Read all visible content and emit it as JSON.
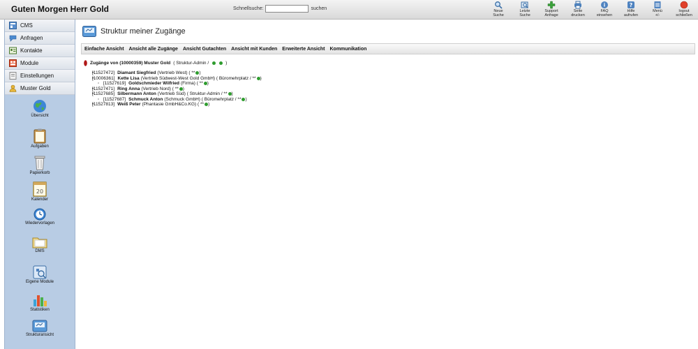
{
  "header": {
    "greeting": "Guten Morgen Herr Gold",
    "search_label": "Schnellsuche:",
    "search_value": "",
    "search_button": "suchen",
    "toolbar": [
      {
        "line1": "Neue",
        "line2": "Suche",
        "icon": "search-icon"
      },
      {
        "line1": "Letzte",
        "line2": "Suche",
        "icon": "history-search-icon"
      },
      {
        "line1": "Support",
        "line2": "Anfrage",
        "icon": "support-icon"
      },
      {
        "line1": "Seite",
        "line2": "drucken",
        "icon": "print-icon"
      },
      {
        "line1": "FAQ",
        "line2": "einsehen",
        "icon": "faq-icon"
      },
      {
        "line1": "Hilfe",
        "line2": "aufrufen",
        "icon": "help-icon"
      },
      {
        "line1": "Menü",
        "line2": "+/-",
        "icon": "menu-icon"
      },
      {
        "line1": "logout",
        "line2": "schließen",
        "icon": "logout-icon"
      }
    ]
  },
  "sidebar": {
    "items": [
      {
        "label": "CMS",
        "icon": "cms-icon"
      },
      {
        "label": "Anfragen",
        "icon": "requests-icon"
      },
      {
        "label": "Kontakte",
        "icon": "contacts-icon"
      },
      {
        "label": "Module",
        "icon": "modules-icon"
      },
      {
        "label": "Einstellungen",
        "icon": "settings-icon"
      },
      {
        "label": "Muster Gold",
        "icon": "user-icon"
      }
    ],
    "modules": [
      {
        "label": "Übersicht",
        "icon": "globe-icon"
      },
      {
        "label": "Aufgaben",
        "icon": "clipboard-icon"
      },
      {
        "label": "Papierkorb",
        "icon": "trash-icon"
      },
      {
        "label": "Kalender",
        "icon": "calendar-icon",
        "day": "20"
      },
      {
        "label": "Wiedervorlagen",
        "icon": "clock-icon"
      },
      {
        "label": "DMS",
        "icon": "folder-icon"
      },
      {
        "label": "Eigene Module",
        "icon": "puzzle-icon"
      },
      {
        "label": "Statistiken",
        "icon": "bar-chart-icon"
      },
      {
        "label": "Strukturansicht",
        "icon": "structure-icon"
      }
    ]
  },
  "main": {
    "title": "Struktur meiner Zugänge",
    "tabs": [
      "Einfache Ansicht",
      "Ansicht alle Zugänge",
      "Ansicht Gutachten",
      "Ansicht mit Kunden",
      "Erweiterte Ansicht",
      "Kommunikation"
    ],
    "tree_head": {
      "bold": "Zugänge von (10000359) Muster Gold",
      "plain": "( Struktur-Admin /",
      "close": ")"
    },
    "tree_rows": [
      {
        "level": 0,
        "id": "[11527472]",
        "name": "Diamant Siegfried",
        "info": "(Vertrieb West)  (  **",
        "end": ")"
      },
      {
        "level": 0,
        "id": "[10006361]",
        "name": "Kette Lisa",
        "info": "(Vertrieb Südwest-West Gold GmbH)  ( Büromehrplatz /  **",
        "end": ")"
      },
      {
        "level": 1,
        "id": "[11527619]",
        "name": "Goldschmieder Wilfried",
        "info": "(Firma)  (  **",
        "end": ")"
      },
      {
        "level": 0,
        "id": "[11527471]",
        "name": "Ring Anna",
        "info": "(Vertrieb Nord)  (  **",
        "end": ")"
      },
      {
        "level": 0,
        "id": "[11527685]",
        "name": "Silbermann Anton",
        "info": "(Vertrieb Süd)  ( Struktur-Admin /  **",
        "end": ")"
      },
      {
        "level": 1,
        "id": "[11527687]",
        "name": "Schmuck Anton",
        "info": "(Schmuck GmbH)  ( Büromehrplatz /  **",
        "end": ")"
      },
      {
        "level": 0,
        "id": "[11527813]",
        "name": "Weiß Peter",
        "info": "(Phantasie GmbH&Co.KG)  (  **",
        "end": ")"
      }
    ]
  },
  "colors": {
    "sidebar_bg": "#b8cce4",
    "status_green": "#2e9c2e",
    "marker_red": "#b01818"
  }
}
